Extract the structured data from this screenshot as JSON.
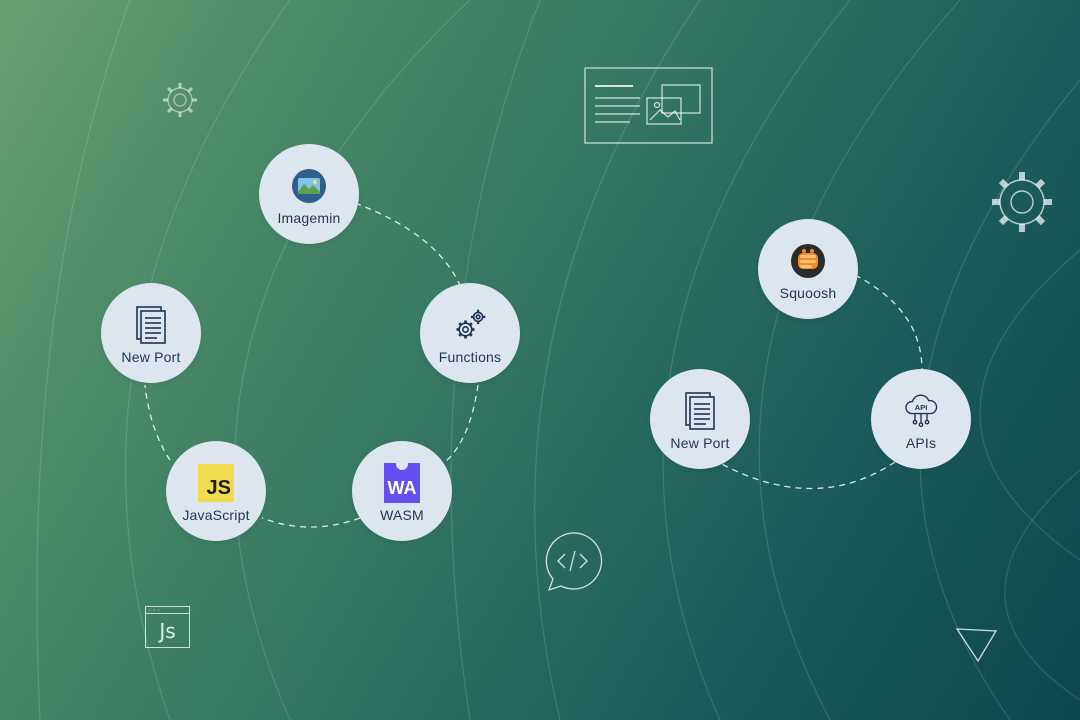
{
  "nodes": {
    "imagemin": "Imagemin",
    "functions": "Functions",
    "new_port_left": "New Port",
    "javascript": "JavaScript",
    "wasm": "WASM",
    "squoosh": "Squoosh",
    "new_port_right": "New Port",
    "apis": "APIs"
  },
  "badges": {
    "js": "JS",
    "wa": "WA",
    "api": "API"
  },
  "decorations": {
    "js_window": "Js",
    "code_bubble": "</>"
  },
  "colors": {
    "node_fill": "#dde6ef",
    "label_text": "#1f3552",
    "js_yellow": "#f0db4f",
    "wasm_purple": "#654ff0"
  }
}
